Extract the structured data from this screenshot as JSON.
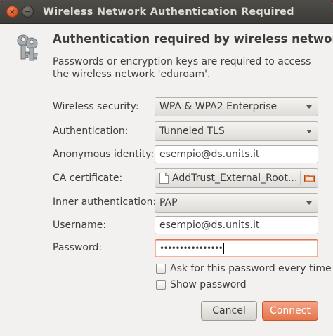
{
  "window": {
    "title": "Wireless Network Authentication Required",
    "close_glyph": "×",
    "minimize_glyph": "−"
  },
  "icon": "keys-icon",
  "heading": "Authentication required by wireless network",
  "description": "Passwords or encryption keys are required to access the wireless network 'eduroam'.",
  "form": {
    "wireless_security": {
      "label": "Wireless security:",
      "value": "WPA & WPA2 Enterprise"
    },
    "authentication": {
      "label": "Authentication:",
      "value": "Tunneled TLS"
    },
    "anonymous_identity": {
      "label": "Anonymous identity:",
      "value": "esempio@ds.units.it"
    },
    "ca_certificate": {
      "label": "CA certificate:",
      "value": "AddTrust_External_Root.…"
    },
    "inner_authentication": {
      "label": "Inner authentication:",
      "value": "PAP"
    },
    "username": {
      "label": "Username:",
      "value": "esempio@ds.units.it"
    },
    "password": {
      "label": "Password:",
      "value": "••••••••••••••••"
    },
    "ask_password": {
      "label": "Ask for this password every time",
      "checked": false
    },
    "show_password": {
      "label": "Show password",
      "checked": false
    }
  },
  "buttons": {
    "cancel": "Cancel",
    "connect": "Connect"
  },
  "colors": {
    "accent": "#e6754c",
    "titlebar": "#3c3b37",
    "dialog_bg": "#f2f1f0"
  }
}
